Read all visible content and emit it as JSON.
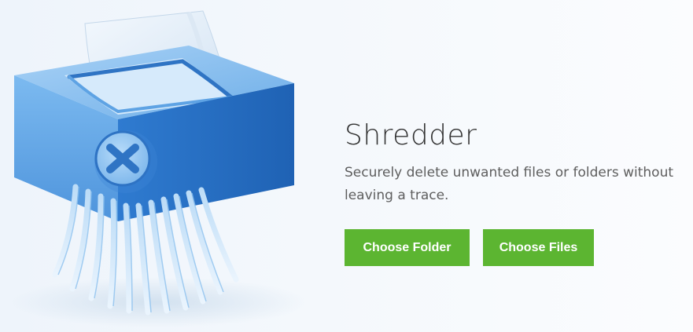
{
  "shredder": {
    "title": "Shredder",
    "description": "Securely delete unwanted files or folders without leaving a trace.",
    "icon": "shredder-icon",
    "badge_icon": "close-icon"
  },
  "actions": {
    "choose_folder_label": "Choose Folder",
    "choose_files_label": "Choose Files"
  },
  "colors": {
    "button_green": "#5cb531",
    "shredder_blue": "#3d8bd9"
  }
}
